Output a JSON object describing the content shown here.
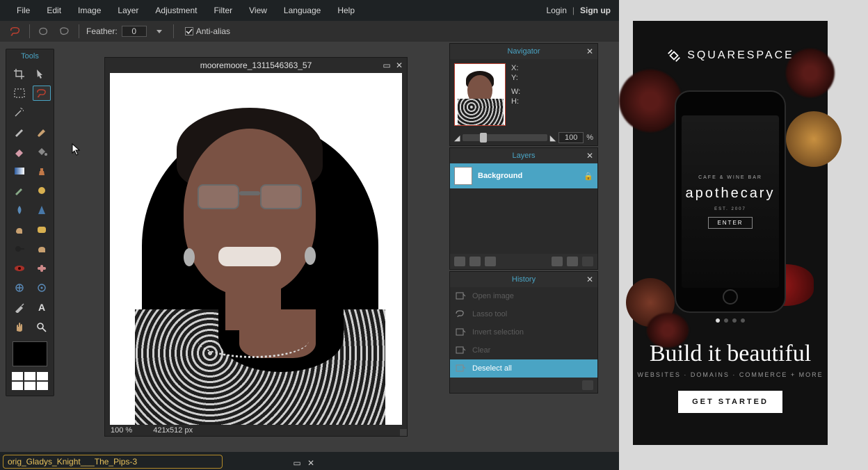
{
  "menu": {
    "file": "File",
    "edit": "Edit",
    "image": "Image",
    "layer": "Layer",
    "adjustment": "Adjustment",
    "filter": "Filter",
    "view": "View",
    "language": "Language",
    "help": "Help",
    "login": "Login",
    "sep": "|",
    "signup": "Sign up"
  },
  "options": {
    "feather_label": "Feather:",
    "feather_value": "0",
    "antialias_label": "Anti-alias"
  },
  "tools_panel": {
    "title": "Tools"
  },
  "canvas": {
    "title": "mooremoore_1311546363_57",
    "zoom": "100  %",
    "dims": "421x512 px"
  },
  "navigator": {
    "title": "Navigator",
    "x_label": "X:",
    "y_label": "Y:",
    "w_label": "W:",
    "h_label": "H:",
    "zoom_value": "100",
    "pct": "%"
  },
  "layers": {
    "title": "Layers",
    "bg": "Background"
  },
  "history": {
    "title": "History",
    "items": [
      {
        "label": "Open image",
        "active": false
      },
      {
        "label": "Lasso tool",
        "active": false
      },
      {
        "label": "Invert selection",
        "active": false
      },
      {
        "label": "Clear",
        "active": false
      },
      {
        "label": "Deselect all",
        "active": true
      }
    ]
  },
  "bottom": {
    "tab": "orig_Gladys_Knight___The_Pips-3"
  },
  "ad": {
    "brand": "SQUARESPACE",
    "phone_title": "apothecary",
    "phone_btn": "ENTER",
    "script": "Build it beautiful",
    "tagline": "WEBSITES · DOMAINS · COMMERCE + MORE",
    "cta": "GET STARTED"
  }
}
